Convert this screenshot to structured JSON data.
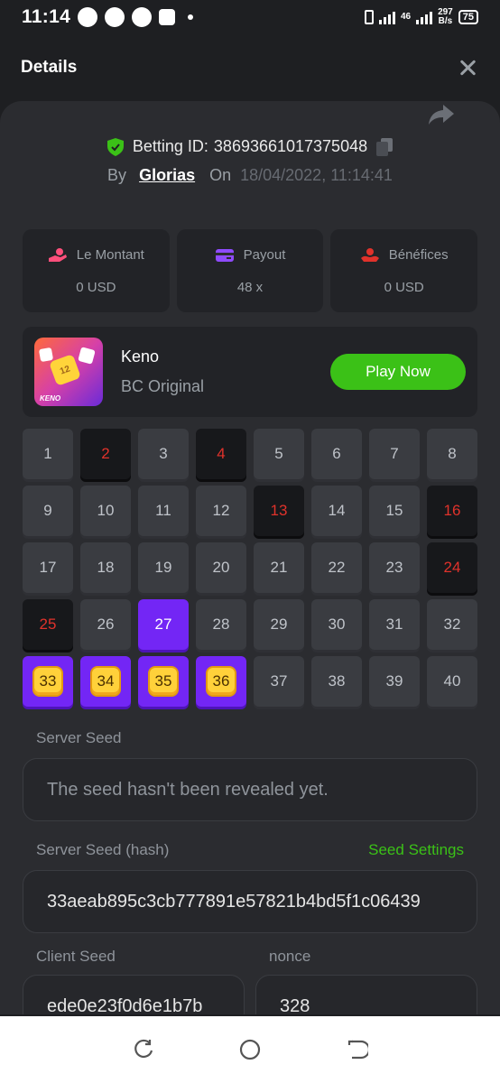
{
  "status": {
    "time": "11:14",
    "net_top": "46",
    "net_bottom": "297",
    "net_unit": "B/s",
    "battery": "75"
  },
  "header": {
    "title": "Details"
  },
  "bet": {
    "id_label": "Betting ID:",
    "id": "38693661017375048",
    "by_label": "By",
    "user": "Glorias",
    "on_label": "On",
    "datetime": "18/04/2022, 11:14:41"
  },
  "stats": [
    {
      "label": "Le Montant",
      "value": "0 USD",
      "icon": "money-hand-icon",
      "color": "#ff4f7b"
    },
    {
      "label": "Payout",
      "value": "48 x",
      "icon": "card-icon",
      "color": "#8f4bff"
    },
    {
      "label": "Bénéfices",
      "value": "0 USD",
      "icon": "profit-icon",
      "color": "#e0322b"
    }
  ],
  "game": {
    "name": "Keno",
    "provider": "BC Original",
    "play_label": "Play Now",
    "thumb_text": "KENO",
    "thumb_number": "12"
  },
  "grid": [
    {
      "n": "1",
      "s": "normal"
    },
    {
      "n": "2",
      "s": "miss"
    },
    {
      "n": "3",
      "s": "normal"
    },
    {
      "n": "4",
      "s": "miss"
    },
    {
      "n": "5",
      "s": "normal"
    },
    {
      "n": "6",
      "s": "normal"
    },
    {
      "n": "7",
      "s": "normal"
    },
    {
      "n": "8",
      "s": "normal"
    },
    {
      "n": "9",
      "s": "normal"
    },
    {
      "n": "10",
      "s": "normal"
    },
    {
      "n": "11",
      "s": "normal"
    },
    {
      "n": "12",
      "s": "normal"
    },
    {
      "n": "13",
      "s": "miss"
    },
    {
      "n": "14",
      "s": "normal"
    },
    {
      "n": "15",
      "s": "normal"
    },
    {
      "n": "16",
      "s": "miss"
    },
    {
      "n": "17",
      "s": "normal"
    },
    {
      "n": "18",
      "s": "normal"
    },
    {
      "n": "19",
      "s": "normal"
    },
    {
      "n": "20",
      "s": "normal"
    },
    {
      "n": "21",
      "s": "normal"
    },
    {
      "n": "22",
      "s": "normal"
    },
    {
      "n": "23",
      "s": "normal"
    },
    {
      "n": "24",
      "s": "miss"
    },
    {
      "n": "25",
      "s": "miss"
    },
    {
      "n": "26",
      "s": "normal"
    },
    {
      "n": "27",
      "s": "pick"
    },
    {
      "n": "28",
      "s": "normal"
    },
    {
      "n": "29",
      "s": "normal"
    },
    {
      "n": "30",
      "s": "normal"
    },
    {
      "n": "31",
      "s": "normal"
    },
    {
      "n": "32",
      "s": "normal"
    },
    {
      "n": "33",
      "s": "hit"
    },
    {
      "n": "34",
      "s": "hit"
    },
    {
      "n": "35",
      "s": "hit"
    },
    {
      "n": "36",
      "s": "hit"
    },
    {
      "n": "37",
      "s": "normal"
    },
    {
      "n": "38",
      "s": "normal"
    },
    {
      "n": "39",
      "s": "normal"
    },
    {
      "n": "40",
      "s": "normal"
    }
  ],
  "seeds": {
    "server_label": "Server Seed",
    "server_value": "The seed hasn't been revealed yet.",
    "hash_label": "Server Seed (hash)",
    "settings_label": "Seed Settings",
    "hash_value": "33aeab895c3cb777891e57821b4bd5f1c06439",
    "client_label": "Client Seed",
    "client_value": "ede0e23f0d6e1b7b",
    "nonce_label": "nonce",
    "nonce_value": "328"
  },
  "colors": {
    "accent_green": "#3bc117",
    "accent_purple": "#7326f5",
    "miss_red": "#e0322b"
  }
}
